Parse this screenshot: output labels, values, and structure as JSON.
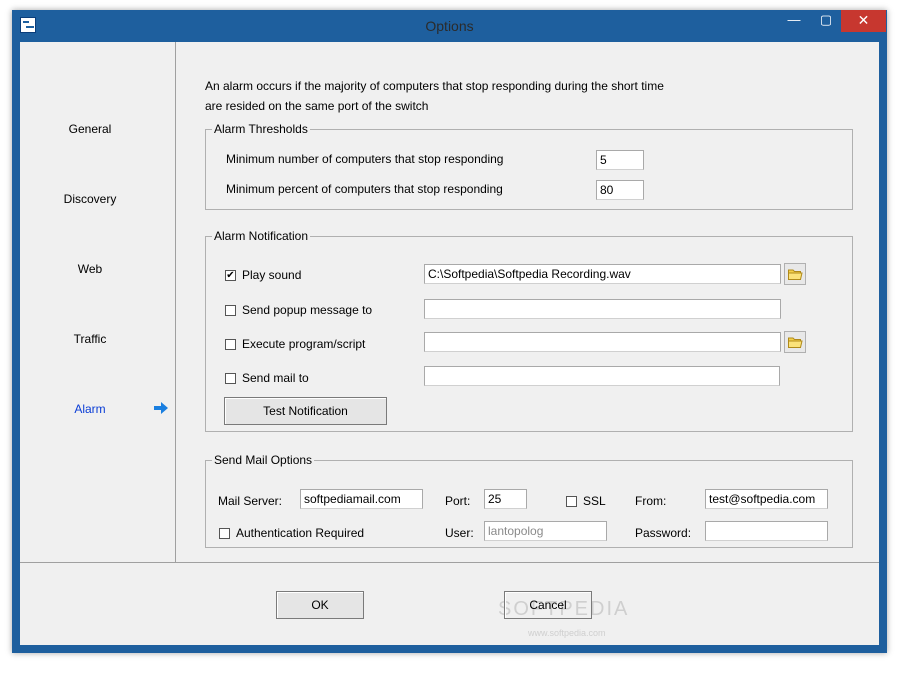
{
  "window": {
    "title": "Options",
    "controls": {
      "minimize": "—",
      "maximize": "▢",
      "close": "✕"
    }
  },
  "sidebar": {
    "items": [
      {
        "label": "General"
      },
      {
        "label": "Discovery"
      },
      {
        "label": "Web"
      },
      {
        "label": "Traffic"
      },
      {
        "label": "Alarm"
      }
    ],
    "active": "Alarm",
    "active_icon": "arrow-right-icon",
    "active_color": "#0a3dd6"
  },
  "intro": {
    "line1": "An alarm occurs if the majority of computers that stop responding  during the short time",
    "line2": "are resided on the same port of the switch"
  },
  "thresholds": {
    "legend": "Alarm Thresholds",
    "min_count_label": "Minimum number of computers that stop responding",
    "min_count_value": "5",
    "min_percent_label": "Minimum percent of computers that stop responding",
    "min_percent_value": "80"
  },
  "notification": {
    "legend": "Alarm Notification",
    "play_sound": {
      "label": "Play sound",
      "checked": true,
      "check_mark": "✔",
      "value": "C:\\Softpedia\\Softpedia Recording.wav"
    },
    "popup": {
      "label": "Send popup message to",
      "checked": false,
      "value": ""
    },
    "execute": {
      "label": "Execute program/script",
      "checked": false,
      "value": ""
    },
    "mail": {
      "label": "Send mail to",
      "checked": false,
      "value": ""
    },
    "folder_icon": "folder-icon",
    "test_button": "Test Notification"
  },
  "mail_options": {
    "legend": "Send Mail Options",
    "server_label": "Mail Server:",
    "server_value": "softpediamail.com",
    "port_label": "Port:",
    "port_value": "25",
    "ssl_label": "SSL",
    "ssl_checked": false,
    "from_label": "From:",
    "from_value": "test@softpedia.com",
    "auth_label": "Authentication Required",
    "auth_checked": false,
    "user_label": "User:",
    "user_value": "lantopolog",
    "password_label": "Password:",
    "password_value": ""
  },
  "footer": {
    "ok": "OK",
    "cancel": "Cancel",
    "watermark": "SOFTPEDIA",
    "watermark_sub": "www.softpedia.com"
  },
  "colors": {
    "title_bar": "#1e5f9e",
    "close_button": "#c7372f",
    "client_bg": "#f0f0f0"
  }
}
